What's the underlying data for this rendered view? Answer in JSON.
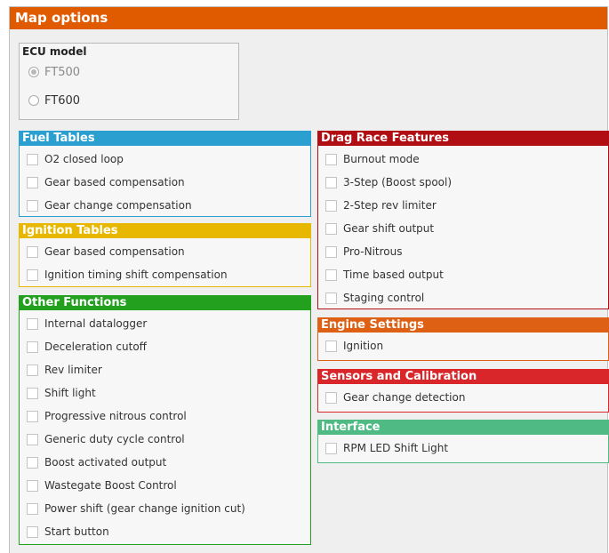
{
  "window": {
    "title": "Map options"
  },
  "ecu": {
    "label": "ECU model",
    "options": [
      {
        "label": "FT500",
        "selected": true
      },
      {
        "label": "FT600",
        "selected": false
      }
    ]
  },
  "groups": {
    "fuel": {
      "title": "Fuel Tables",
      "color": "#2a9fd0",
      "items": [
        "O2 closed loop",
        "Gear based compensation",
        "Gear change compensation"
      ]
    },
    "ignition": {
      "title": "Ignition Tables",
      "color": "#e8b800",
      "items": [
        "Gear based compensation",
        "Ignition timing shift compensation"
      ]
    },
    "other": {
      "title": "Other Functions",
      "color": "#22a01e",
      "items": [
        "Internal datalogger",
        "Deceleration cutoff",
        "Rev limiter",
        "Shift light",
        "Progressive nitrous control",
        "Generic duty cycle control",
        "Boost activated output",
        "Wastegate Boost Control",
        "Power shift (gear change ignition cut)",
        "Start button"
      ]
    },
    "drag": {
      "title": "Drag Race Features",
      "color": "#b00e12",
      "items": [
        "Burnout mode",
        "3-Step (Boost spool)",
        "2-Step rev limiter",
        "Gear shift output",
        "Pro-Nitrous",
        "Time based output",
        "Staging control"
      ]
    },
    "engine": {
      "title": "Engine Settings",
      "color": "#de6014",
      "items": [
        "Ignition"
      ]
    },
    "sensors": {
      "title": "Sensors and Calibration",
      "color": "#d8262a",
      "items": [
        "Gear change detection"
      ]
    },
    "interface": {
      "title": "Interface",
      "color": "#4fba84",
      "items": [
        "RPM LED Shift Light"
      ]
    }
  }
}
